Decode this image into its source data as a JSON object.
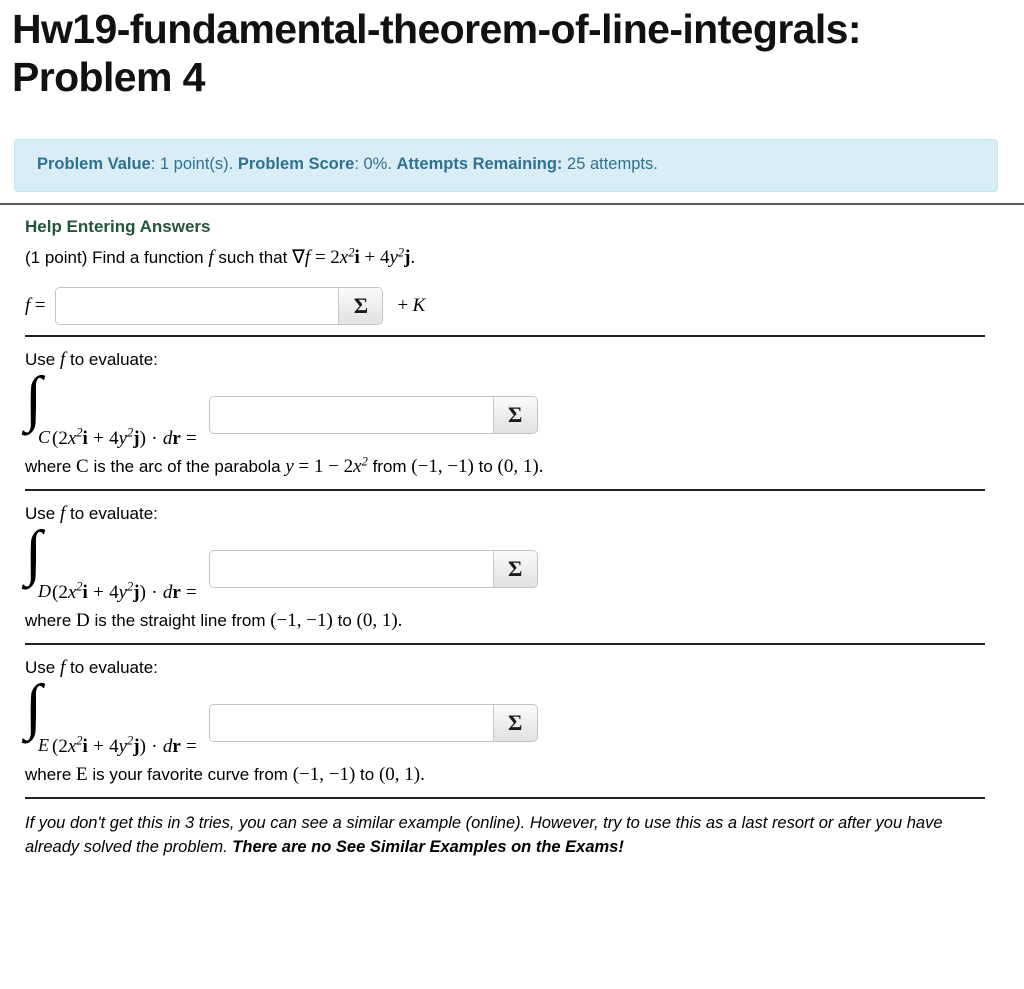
{
  "page": {
    "title": "Hw19-fundamental-theorem-of-line-integrals: Problem 4"
  },
  "status_bar": {
    "problem_value_label": "Problem Value",
    "problem_value": ": 1 point(s). ",
    "problem_score_label": "Problem Score",
    "problem_score": ": 0%. ",
    "attempts_label": "Attempts Remaining:",
    "attempts_value": " 25 attempts.",
    "background_color": "#d9edf7",
    "text_color": "#31708f"
  },
  "help": {
    "link_label": "Help Entering Answers",
    "link_color": "#24543d"
  },
  "problem": {
    "points_prefix": "(1 point) Find a function",
    "f_symbol": "f",
    "such_that": "such that",
    "nabla": "∇",
    "equals": "=",
    "coef_x": "2",
    "var_x": "x",
    "exp_x": "2",
    "vec_i": "i",
    "plus": "+",
    "coef_y": "4",
    "var_y": "y",
    "exp_y": "2",
    "vec_j": "j",
    "period": "."
  },
  "answer_f": {
    "label_f": "f",
    "label_eq": "=",
    "value": "",
    "placeholder": "",
    "sigma_label": "Σ",
    "suffix_plus": "+",
    "suffix_K": "K"
  },
  "sections": [
    {
      "use_prefix": "Use",
      "use_symbol": "f",
      "use_suffix": "to evaluate:",
      "integral_symbol": "∫",
      "limit": "C",
      "open_paren": "(",
      "coef_x": "2",
      "var_x": "x",
      "exp_x": "2",
      "vec_i": "i",
      "plus": "+",
      "coef_y": "4",
      "var_y": "y",
      "exp_y": "2",
      "vec_j": "j",
      "close_paren": ")",
      "dot": "·",
      "d_symbol": "d",
      "r_symbol": "r",
      "equals": "=",
      "value": "",
      "sigma_label": "Σ",
      "where_prefix": "where",
      "curve": "C",
      "where_text": "is the arc of the parabola",
      "curve_eq_y": "y",
      "curve_eq_equals": "=",
      "curve_eq_one": "1",
      "curve_eq_minus": "−",
      "curve_eq_coef": "2",
      "curve_eq_x": "x",
      "curve_eq_exp": "2",
      "from_label": "from",
      "point_start": "(−1, −1)",
      "to_label": "to",
      "point_end": "(0, 1)",
      "end_period": "."
    },
    {
      "use_prefix": "Use",
      "use_symbol": "f",
      "use_suffix": "to evaluate:",
      "integral_symbol": "∫",
      "limit": "D",
      "open_paren": "(",
      "coef_x": "2",
      "var_x": "x",
      "exp_x": "2",
      "vec_i": "i",
      "plus": "+",
      "coef_y": "4",
      "var_y": "y",
      "exp_y": "2",
      "vec_j": "j",
      "close_paren": ")",
      "dot": "·",
      "d_symbol": "d",
      "r_symbol": "r",
      "equals": "=",
      "value": "",
      "sigma_label": "Σ",
      "where_prefix": "where",
      "curve": "D",
      "where_text": "is the straight line from",
      "point_start": "(−1, −1)",
      "to_label": "to",
      "point_end": "(0, 1)",
      "end_period": "."
    },
    {
      "use_prefix": "Use",
      "use_symbol": "f",
      "use_suffix": "to evaluate:",
      "integral_symbol": "∫",
      "limit": "E",
      "open_paren": "(",
      "coef_x": "2",
      "var_x": "x",
      "exp_x": "2",
      "vec_i": "i",
      "plus": "+",
      "coef_y": "4",
      "var_y": "y",
      "exp_y": "2",
      "vec_j": "j",
      "close_paren": ")",
      "dot": "·",
      "d_symbol": "d",
      "r_symbol": "r",
      "equals": "=",
      "value": "",
      "sigma_label": "Σ",
      "where_prefix": "where",
      "curve": "E",
      "where_text": "is your favorite curve from",
      "point_start": "(−1, −1)",
      "to_label": "to",
      "point_end": "(0, 1)",
      "end_period": "."
    }
  ],
  "footnote": {
    "line1": "If you don't get this in 3 tries, you can see a similar example (online). However, try to use this as a last",
    "line2_plain": "resort or after you have already solved the problem. ",
    "line2_bold": "There are no See Similar Examples on the Exams!"
  }
}
